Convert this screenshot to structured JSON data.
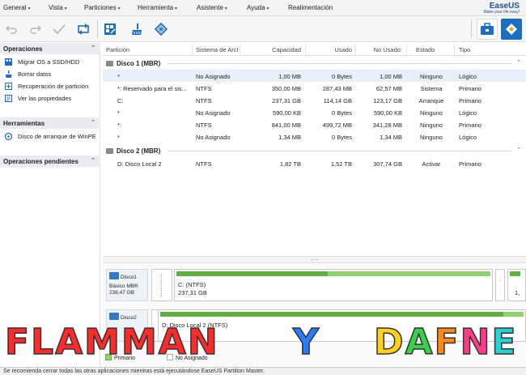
{
  "menu": {
    "items": [
      "General",
      "Vista",
      "Particiones",
      "Herramienta",
      "Asistente",
      "Ayuda",
      "Realimentación"
    ],
    "brand": "EaseUS",
    "tagline": "Make your life easy!"
  },
  "toolbar": {
    "icons": [
      "undo-icon",
      "redo-icon",
      "apply-check-icon",
      "refresh-icon",
      "migrate-os-icon",
      "wipe-data-icon",
      "partition-recovery-icon",
      "toolbox-icon",
      "easeus-icon"
    ]
  },
  "sidebar": {
    "sections": [
      {
        "title": "Operaciones",
        "items": [
          "Migrar OS a SSD/HDD",
          "Borrar datos",
          "Recuperación de partición",
          "Ver las propiedades"
        ]
      },
      {
        "title": "Herramientas",
        "items": [
          "Disco de arranque de WinPE"
        ]
      },
      {
        "title": "Operaciones pendientes",
        "items": []
      }
    ]
  },
  "table": {
    "columns": [
      "Partición",
      "Sistema de Arch",
      "Capacidad",
      "Usado",
      "No Usado:",
      "Estado",
      "Tipo"
    ],
    "disks": [
      {
        "title": "Disco 1 (MBR)",
        "rows": [
          [
            "*",
            "No Asignado",
            "1,00 MB",
            "0 Bytes",
            "1,00 MB",
            "Ninguno",
            "Lógico"
          ],
          [
            "*: Reservado para el sis...",
            "NTFS",
            "350,00 MB",
            "287,43 MB",
            "62,57 MB",
            "Sistema",
            "Primario"
          ],
          [
            "C:",
            "NTFS",
            "237,31 GB",
            "114,14 GB",
            "123,17 GB",
            "Arranque",
            "Primario"
          ],
          [
            "*",
            "No Asignado",
            "590,00 KB",
            "0 Bytes",
            "590,00 KB",
            "Ninguno",
            "Lógico"
          ],
          [
            "*:",
            "NTFS",
            "841,00 MB",
            "499,72 MB",
            "341,28 MB",
            "Ninguno",
            "Primario"
          ],
          [
            "*",
            "No Asignado",
            "1,34 MB",
            "0 Bytes",
            "1,34 MB",
            "Ninguno",
            "Lógico"
          ]
        ]
      },
      {
        "title": "Disco 2 (MBR)",
        "rows": [
          [
            "D: Disco Local 2",
            "NTFS",
            "1,82 TB",
            "1,52 TB",
            "307,74 GB",
            "Activar",
            "Primario"
          ]
        ]
      }
    ]
  },
  "splitter": "......",
  "diskmap": {
    "disk1": {
      "name": "Disco1",
      "type": "Básico MBR",
      "size": "238,47 GB",
      "main_label": "C: (NTFS)",
      "main_size": "237,31 GB",
      "main_used_fraction": 0.48,
      "tail_marker": "1,"
    },
    "disk2": {
      "name": "Disco2",
      "main_label": "D: Disco Local 2 (NTFS)",
      "main_used_fraction": 0.94
    }
  },
  "legend": {
    "primary": "Primario",
    "unallocated": "No Asignado"
  },
  "status": "Se recomienda cerrar todas las otras aplicaciones mientras está ejecutándose EaseUS Partition Master.",
  "overlay": {
    "words": [
      "FLAMMAN",
      "Y",
      "DAFNE"
    ]
  },
  "colors": {
    "accent": "#1a6fc4",
    "used_green": "#5cb23a",
    "bar_green": "#8fd36a",
    "selected_row": "#e8f0fb"
  }
}
